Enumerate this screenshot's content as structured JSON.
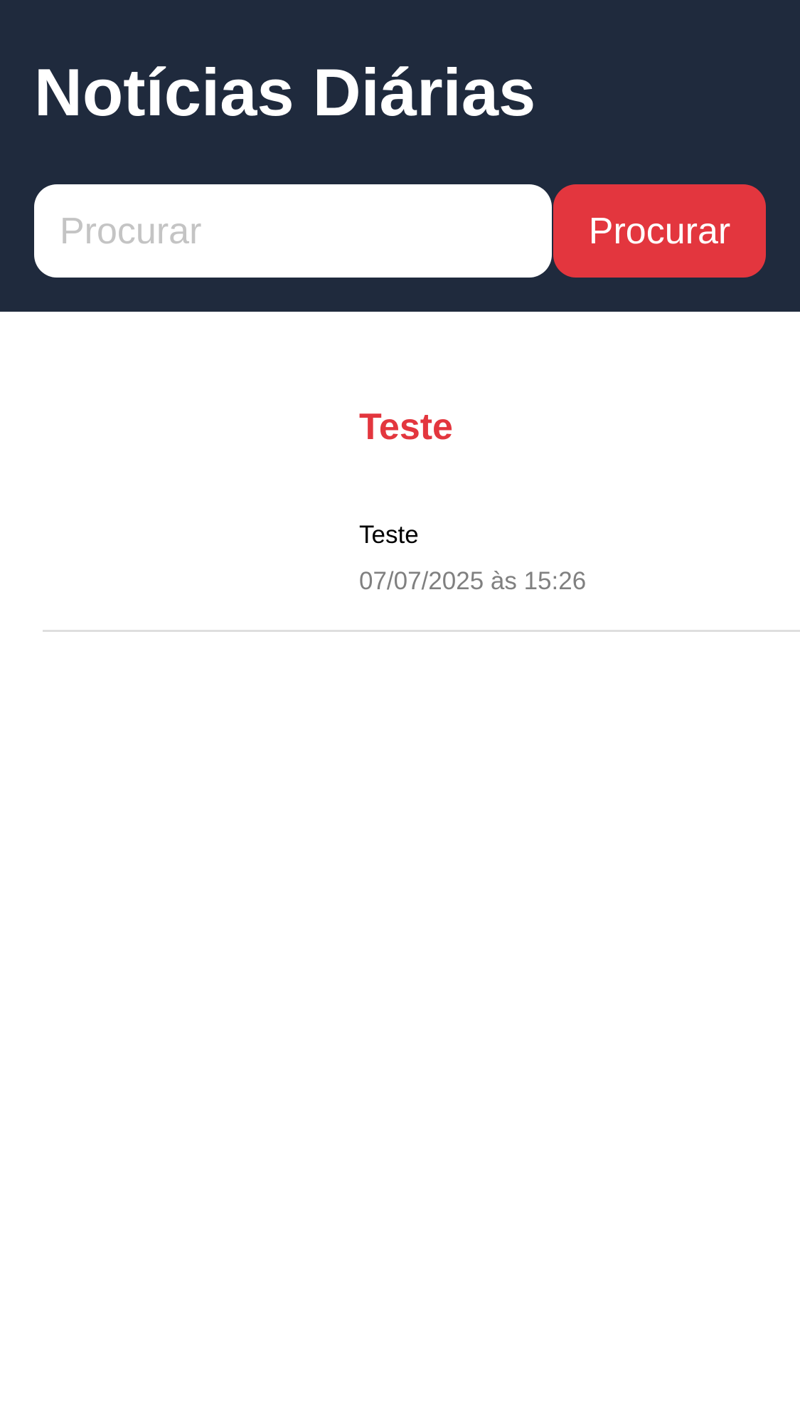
{
  "header": {
    "title": "Notícias Diárias",
    "search_placeholder": "Procurar",
    "search_value": "",
    "search_button_label": "Procurar"
  },
  "news": [
    {
      "title": "Teste",
      "body": "Teste",
      "date": "07/07/2025 às 15:26"
    }
  ],
  "colors": {
    "header_background": "#1f2a3d",
    "accent": "#e3363e",
    "date_text": "#808080",
    "divider": "#dedede"
  }
}
